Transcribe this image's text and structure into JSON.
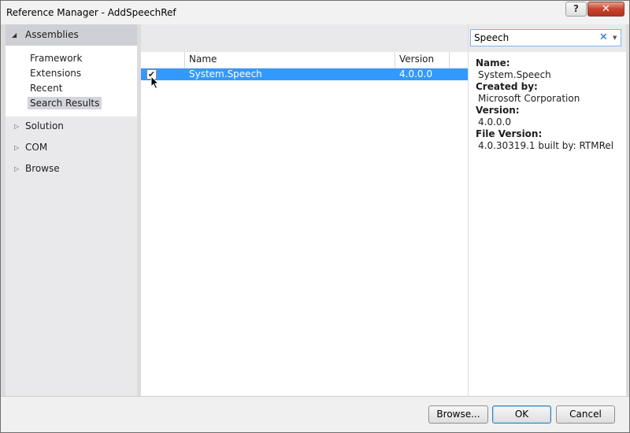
{
  "window": {
    "title": "Reference Manager - AddSpeechRef",
    "help_label": "?",
    "close_label": "✕"
  },
  "sidebar": {
    "header": "Assemblies",
    "sub_items": [
      "Framework",
      "Extensions",
      "Recent",
      "Search Results"
    ],
    "selected": "Search Results",
    "items": [
      "Solution",
      "COM",
      "Browse"
    ]
  },
  "grid": {
    "columns": [
      "Name",
      "Version"
    ],
    "rows": [
      {
        "checked": true,
        "name": "System.Speech",
        "version": "4.0.0.0"
      }
    ]
  },
  "search": {
    "value": "Speech"
  },
  "details": {
    "name_label": "Name:",
    "name_value": "System.Speech",
    "created_label": "Created by:",
    "created_value": "Microsoft Corporation",
    "version_label": "Version:",
    "version_value": "4.0.0.0",
    "file_version_label": "File Version:",
    "file_version_value": "4.0.30319.1 built by: RTMRel"
  },
  "buttons": {
    "browse": "Browse...",
    "ok": "OK",
    "cancel": "Cancel"
  },
  "colors": {
    "selection": "#3399ff",
    "nav_background": "#e9e9ec",
    "close_button": "#c7432c"
  }
}
